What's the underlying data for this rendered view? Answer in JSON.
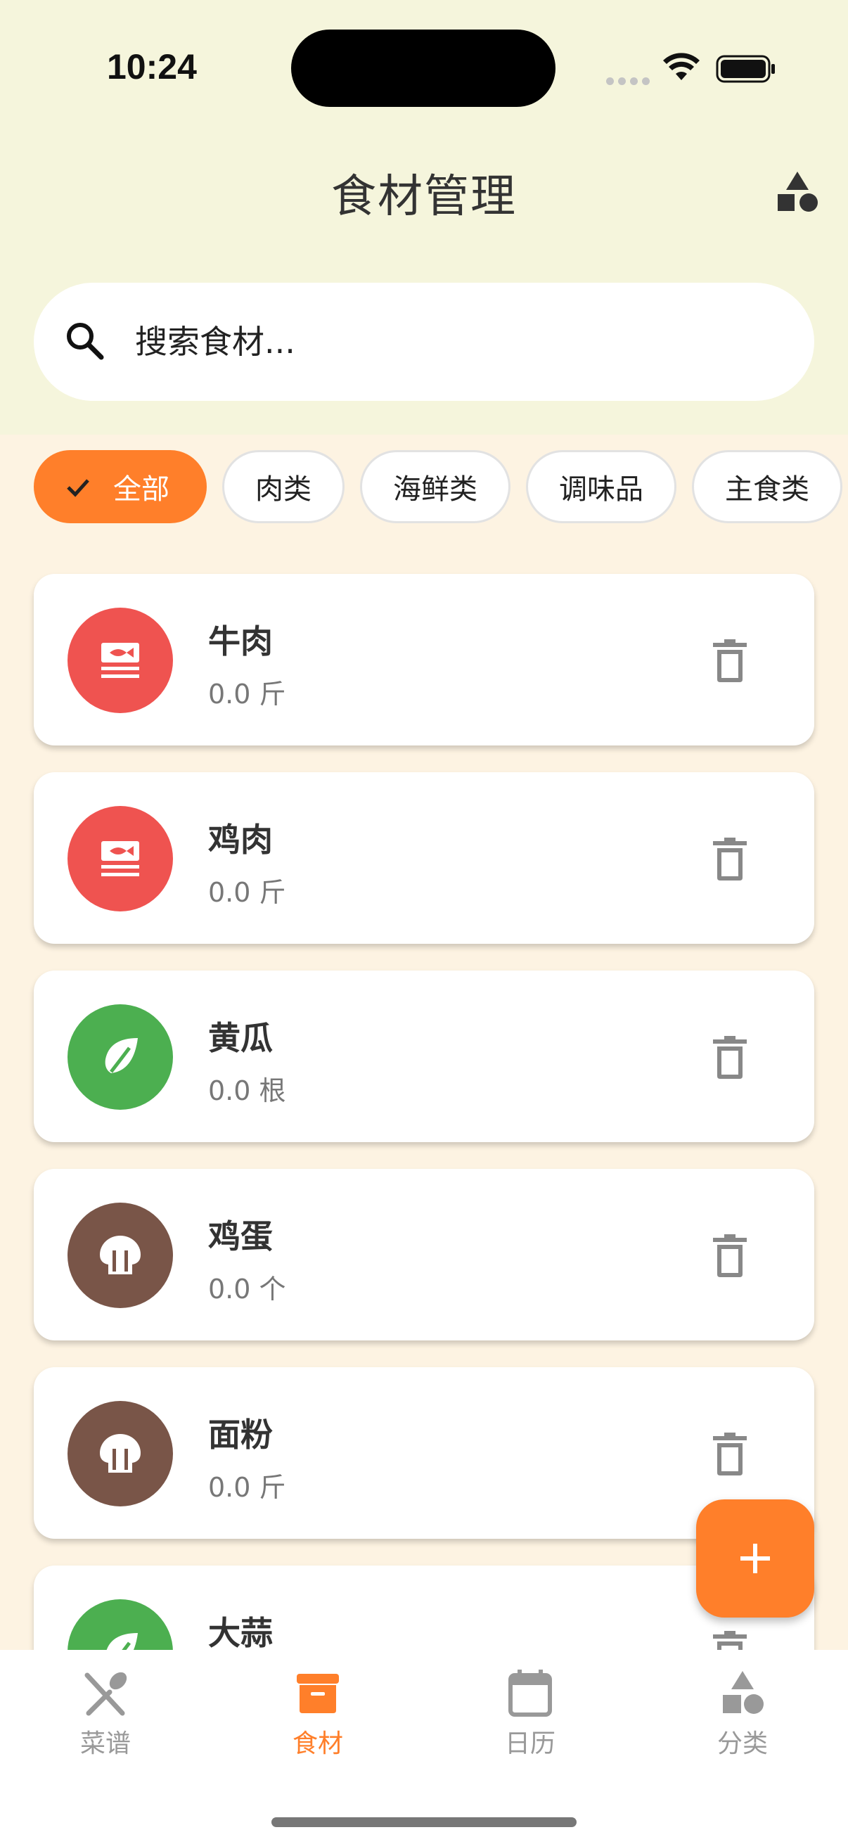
{
  "status_bar": {
    "time": "10:24"
  },
  "header": {
    "title": "食材管理",
    "corner_icon": "category-shapes-icon"
  },
  "search": {
    "placeholder": "搜索食材..."
  },
  "chips": [
    {
      "label": "全部",
      "selected": true
    },
    {
      "label": "肉类",
      "selected": false
    },
    {
      "label": "海鲜类",
      "selected": false
    },
    {
      "label": "调味品",
      "selected": false
    },
    {
      "label": "主食类",
      "selected": false
    }
  ],
  "ingredients": [
    {
      "name": "牛肉",
      "qty": "0.0 斤",
      "icon": "meat-icon",
      "color": "#EF5350"
    },
    {
      "name": "鸡肉",
      "qty": "0.0 斤",
      "icon": "meat-icon",
      "color": "#EF5350"
    },
    {
      "name": "黄瓜",
      "qty": "0.0 根",
      "icon": "leaf-icon",
      "color": "#4CAF50"
    },
    {
      "name": "鸡蛋",
      "qty": "0.0 个",
      "icon": "staple-icon",
      "color": "#795548"
    },
    {
      "name": "面粉",
      "qty": "0.0 斤",
      "icon": "staple-icon",
      "color": "#795548"
    },
    {
      "name": "大蒜",
      "qty": "",
      "icon": "leaf-icon",
      "color": "#4CAF50"
    }
  ],
  "bottom_nav": [
    {
      "label": "菜谱",
      "icon": "utensils-icon",
      "active": false
    },
    {
      "label": "食材",
      "icon": "inventory-box-icon",
      "active": true
    },
    {
      "label": "日历",
      "icon": "calendar-icon",
      "active": false
    },
    {
      "label": "分类",
      "icon": "category-shapes-icon",
      "active": false
    }
  ],
  "colors": {
    "accent": "#FF7F2A",
    "header_bg": "#F5F5DC",
    "list_bg": "#FDF3E2"
  }
}
